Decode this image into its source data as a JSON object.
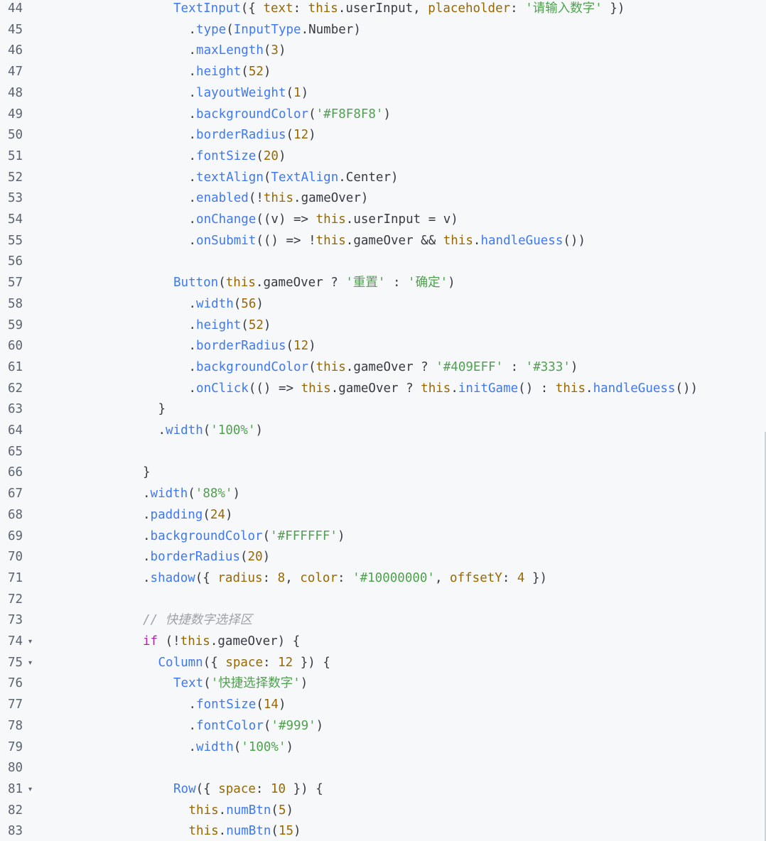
{
  "lines": [
    {
      "n": "44",
      "fold": false,
      "indent": 6,
      "tokens": [
        [
          "fn",
          "TextInput"
        ],
        [
          "plain",
          "({ "
        ],
        [
          "prop",
          "text"
        ],
        [
          "plain",
          ": "
        ],
        [
          "this",
          "this"
        ],
        [
          "plain",
          ".userInput, "
        ],
        [
          "prop",
          "placeholder"
        ],
        [
          "plain",
          ": "
        ],
        [
          "str",
          "'请输入数字'"
        ],
        [
          "plain",
          " })"
        ]
      ]
    },
    {
      "n": "45",
      "fold": false,
      "indent": 7,
      "tokens": [
        [
          "plain",
          "."
        ],
        [
          "fn",
          "type"
        ],
        [
          "plain",
          "("
        ],
        [
          "fn",
          "InputType"
        ],
        [
          "plain",
          ".Number)"
        ]
      ]
    },
    {
      "n": "46",
      "fold": false,
      "indent": 7,
      "tokens": [
        [
          "plain",
          "."
        ],
        [
          "fn",
          "maxLength"
        ],
        [
          "plain",
          "("
        ],
        [
          "num",
          "3"
        ],
        [
          "plain",
          ")"
        ]
      ]
    },
    {
      "n": "47",
      "fold": false,
      "indent": 7,
      "tokens": [
        [
          "plain",
          "."
        ],
        [
          "fn",
          "height"
        ],
        [
          "plain",
          "("
        ],
        [
          "num",
          "52"
        ],
        [
          "plain",
          ")"
        ]
      ]
    },
    {
      "n": "48",
      "fold": false,
      "indent": 7,
      "tokens": [
        [
          "plain",
          "."
        ],
        [
          "fn",
          "layoutWeight"
        ],
        [
          "plain",
          "("
        ],
        [
          "num",
          "1"
        ],
        [
          "plain",
          ")"
        ]
      ]
    },
    {
      "n": "49",
      "fold": false,
      "indent": 7,
      "tokens": [
        [
          "plain",
          "."
        ],
        [
          "fn",
          "backgroundColor"
        ],
        [
          "plain",
          "("
        ],
        [
          "str",
          "'#F8F8F8'"
        ],
        [
          "plain",
          ")"
        ]
      ]
    },
    {
      "n": "50",
      "fold": false,
      "indent": 7,
      "tokens": [
        [
          "plain",
          "."
        ],
        [
          "fn",
          "borderRadius"
        ],
        [
          "plain",
          "("
        ],
        [
          "num",
          "12"
        ],
        [
          "plain",
          ")"
        ]
      ]
    },
    {
      "n": "51",
      "fold": false,
      "indent": 7,
      "tokens": [
        [
          "plain",
          "."
        ],
        [
          "fn",
          "fontSize"
        ],
        [
          "plain",
          "("
        ],
        [
          "num",
          "20"
        ],
        [
          "plain",
          ")"
        ]
      ]
    },
    {
      "n": "52",
      "fold": false,
      "indent": 7,
      "tokens": [
        [
          "plain",
          "."
        ],
        [
          "fn",
          "textAlign"
        ],
        [
          "plain",
          "("
        ],
        [
          "fn",
          "TextAlign"
        ],
        [
          "plain",
          ".Center)"
        ]
      ]
    },
    {
      "n": "53",
      "fold": false,
      "indent": 7,
      "tokens": [
        [
          "plain",
          "."
        ],
        [
          "fn",
          "enabled"
        ],
        [
          "plain",
          "(!"
        ],
        [
          "this",
          "this"
        ],
        [
          "plain",
          ".gameOver)"
        ]
      ]
    },
    {
      "n": "54",
      "fold": false,
      "indent": 7,
      "tokens": [
        [
          "plain",
          "."
        ],
        [
          "fn",
          "onChange"
        ],
        [
          "plain",
          "((v) => "
        ],
        [
          "this",
          "this"
        ],
        [
          "plain",
          ".userInput = v)"
        ]
      ]
    },
    {
      "n": "55",
      "fold": false,
      "indent": 7,
      "tokens": [
        [
          "plain",
          "."
        ],
        [
          "fn",
          "onSubmit"
        ],
        [
          "plain",
          "(() => !"
        ],
        [
          "this",
          "this"
        ],
        [
          "plain",
          ".gameOver && "
        ],
        [
          "this",
          "this"
        ],
        [
          "plain",
          "."
        ],
        [
          "fn",
          "handleGuess"
        ],
        [
          "plain",
          "())"
        ]
      ]
    },
    {
      "n": "56",
      "fold": false,
      "indent": 0,
      "tokens": []
    },
    {
      "n": "57",
      "fold": false,
      "indent": 6,
      "tokens": [
        [
          "fn",
          "Button"
        ],
        [
          "plain",
          "("
        ],
        [
          "this",
          "this"
        ],
        [
          "plain",
          ".gameOver ? "
        ],
        [
          "str",
          "'重置'"
        ],
        [
          "plain",
          " : "
        ],
        [
          "str",
          "'确定'"
        ],
        [
          "plain",
          ")"
        ]
      ]
    },
    {
      "n": "58",
      "fold": false,
      "indent": 7,
      "tokens": [
        [
          "plain",
          "."
        ],
        [
          "fn",
          "width"
        ],
        [
          "plain",
          "("
        ],
        [
          "num",
          "56"
        ],
        [
          "plain",
          ")"
        ]
      ]
    },
    {
      "n": "59",
      "fold": false,
      "indent": 7,
      "tokens": [
        [
          "plain",
          "."
        ],
        [
          "fn",
          "height"
        ],
        [
          "plain",
          "("
        ],
        [
          "num",
          "52"
        ],
        [
          "plain",
          ")"
        ]
      ]
    },
    {
      "n": "60",
      "fold": false,
      "indent": 7,
      "tokens": [
        [
          "plain",
          "."
        ],
        [
          "fn",
          "borderRadius"
        ],
        [
          "plain",
          "("
        ],
        [
          "num",
          "12"
        ],
        [
          "plain",
          ")"
        ]
      ]
    },
    {
      "n": "61",
      "fold": false,
      "indent": 7,
      "tokens": [
        [
          "plain",
          "."
        ],
        [
          "fn",
          "backgroundColor"
        ],
        [
          "plain",
          "("
        ],
        [
          "this",
          "this"
        ],
        [
          "plain",
          ".gameOver ? "
        ],
        [
          "str",
          "'#409EFF'"
        ],
        [
          "plain",
          " : "
        ],
        [
          "str",
          "'#333'"
        ],
        [
          "plain",
          ")"
        ]
      ]
    },
    {
      "n": "62",
      "fold": false,
      "indent": 7,
      "tokens": [
        [
          "plain",
          "."
        ],
        [
          "fn",
          "onClick"
        ],
        [
          "plain",
          "(() => "
        ],
        [
          "this",
          "this"
        ],
        [
          "plain",
          ".gameOver ? "
        ],
        [
          "this",
          "this"
        ],
        [
          "plain",
          "."
        ],
        [
          "fn",
          "initGame"
        ],
        [
          "plain",
          "() : "
        ],
        [
          "this",
          "this"
        ],
        [
          "plain",
          "."
        ],
        [
          "fn",
          "handleGuess"
        ],
        [
          "plain",
          "())"
        ]
      ]
    },
    {
      "n": "63",
      "fold": false,
      "indent": 5,
      "tokens": [
        [
          "plain",
          "}"
        ]
      ]
    },
    {
      "n": "64",
      "fold": false,
      "indent": 5,
      "tokens": [
        [
          "plain",
          "."
        ],
        [
          "fn",
          "width"
        ],
        [
          "plain",
          "("
        ],
        [
          "str",
          "'100%'"
        ],
        [
          "plain",
          ")"
        ]
      ]
    },
    {
      "n": "65",
      "fold": false,
      "indent": 0,
      "tokens": []
    },
    {
      "n": "66",
      "fold": false,
      "indent": 4,
      "tokens": [
        [
          "plain",
          "}"
        ]
      ]
    },
    {
      "n": "67",
      "fold": false,
      "indent": 4,
      "tokens": [
        [
          "plain",
          "."
        ],
        [
          "fn",
          "width"
        ],
        [
          "plain",
          "("
        ],
        [
          "str",
          "'88%'"
        ],
        [
          "plain",
          ")"
        ]
      ]
    },
    {
      "n": "68",
      "fold": false,
      "indent": 4,
      "tokens": [
        [
          "plain",
          "."
        ],
        [
          "fn",
          "padding"
        ],
        [
          "plain",
          "("
        ],
        [
          "num",
          "24"
        ],
        [
          "plain",
          ")"
        ]
      ]
    },
    {
      "n": "69",
      "fold": false,
      "indent": 4,
      "tokens": [
        [
          "plain",
          "."
        ],
        [
          "fn",
          "backgroundColor"
        ],
        [
          "plain",
          "("
        ],
        [
          "str",
          "'#FFFFFF'"
        ],
        [
          "plain",
          ")"
        ]
      ]
    },
    {
      "n": "70",
      "fold": false,
      "indent": 4,
      "tokens": [
        [
          "plain",
          "."
        ],
        [
          "fn",
          "borderRadius"
        ],
        [
          "plain",
          "("
        ],
        [
          "num",
          "20"
        ],
        [
          "plain",
          ")"
        ]
      ]
    },
    {
      "n": "71",
      "fold": false,
      "indent": 4,
      "tokens": [
        [
          "plain",
          "."
        ],
        [
          "fn",
          "shadow"
        ],
        [
          "plain",
          "({ "
        ],
        [
          "prop",
          "radius"
        ],
        [
          "plain",
          ": "
        ],
        [
          "num",
          "8"
        ],
        [
          "plain",
          ", "
        ],
        [
          "prop",
          "color"
        ],
        [
          "plain",
          ": "
        ],
        [
          "str",
          "'#10000000'"
        ],
        [
          "plain",
          ", "
        ],
        [
          "prop",
          "offsetY"
        ],
        [
          "plain",
          ": "
        ],
        [
          "num",
          "4"
        ],
        [
          "plain",
          " })"
        ]
      ]
    },
    {
      "n": "72",
      "fold": false,
      "indent": 0,
      "tokens": []
    },
    {
      "n": "73",
      "fold": false,
      "indent": 4,
      "tokens": [
        [
          "cmt",
          "// 快捷数字选择区"
        ]
      ]
    },
    {
      "n": "74",
      "fold": true,
      "indent": 4,
      "tokens": [
        [
          "kw",
          "if"
        ],
        [
          "plain",
          " (!"
        ],
        [
          "this",
          "this"
        ],
        [
          "plain",
          ".gameOver) {"
        ]
      ]
    },
    {
      "n": "75",
      "fold": true,
      "indent": 5,
      "tokens": [
        [
          "fn",
          "Column"
        ],
        [
          "plain",
          "({ "
        ],
        [
          "prop",
          "space"
        ],
        [
          "plain",
          ": "
        ],
        [
          "num",
          "12"
        ],
        [
          "plain",
          " }) {"
        ]
      ]
    },
    {
      "n": "76",
      "fold": false,
      "indent": 6,
      "tokens": [
        [
          "fn",
          "Text"
        ],
        [
          "plain",
          "("
        ],
        [
          "str",
          "'快捷选择数字'"
        ],
        [
          "plain",
          ")"
        ]
      ]
    },
    {
      "n": "77",
      "fold": false,
      "indent": 7,
      "tokens": [
        [
          "plain",
          "."
        ],
        [
          "fn",
          "fontSize"
        ],
        [
          "plain",
          "("
        ],
        [
          "num",
          "14"
        ],
        [
          "plain",
          ")"
        ]
      ]
    },
    {
      "n": "78",
      "fold": false,
      "indent": 7,
      "tokens": [
        [
          "plain",
          "."
        ],
        [
          "fn",
          "fontColor"
        ],
        [
          "plain",
          "("
        ],
        [
          "str",
          "'#999'"
        ],
        [
          "plain",
          ")"
        ]
      ]
    },
    {
      "n": "79",
      "fold": false,
      "indent": 7,
      "tokens": [
        [
          "plain",
          "."
        ],
        [
          "fn",
          "width"
        ],
        [
          "plain",
          "("
        ],
        [
          "str",
          "'100%'"
        ],
        [
          "plain",
          ")"
        ]
      ]
    },
    {
      "n": "80",
      "fold": false,
      "indent": 0,
      "tokens": []
    },
    {
      "n": "81",
      "fold": true,
      "indent": 6,
      "tokens": [
        [
          "fn",
          "Row"
        ],
        [
          "plain",
          "({ "
        ],
        [
          "prop",
          "space"
        ],
        [
          "plain",
          ": "
        ],
        [
          "num",
          "10"
        ],
        [
          "plain",
          " }) {"
        ]
      ]
    },
    {
      "n": "82",
      "fold": false,
      "indent": 7,
      "tokens": [
        [
          "this",
          "this"
        ],
        [
          "plain",
          "."
        ],
        [
          "fn",
          "numBtn"
        ],
        [
          "plain",
          "("
        ],
        [
          "num",
          "5"
        ],
        [
          "plain",
          ")"
        ]
      ]
    },
    {
      "n": "83",
      "fold": false,
      "indent": 7,
      "tokens": [
        [
          "this",
          "this"
        ],
        [
          "plain",
          "."
        ],
        [
          "fn",
          "numBtn"
        ],
        [
          "plain",
          "("
        ],
        [
          "num",
          "15"
        ],
        [
          "plain",
          ")"
        ]
      ]
    }
  ],
  "fold_glyph": "▾"
}
